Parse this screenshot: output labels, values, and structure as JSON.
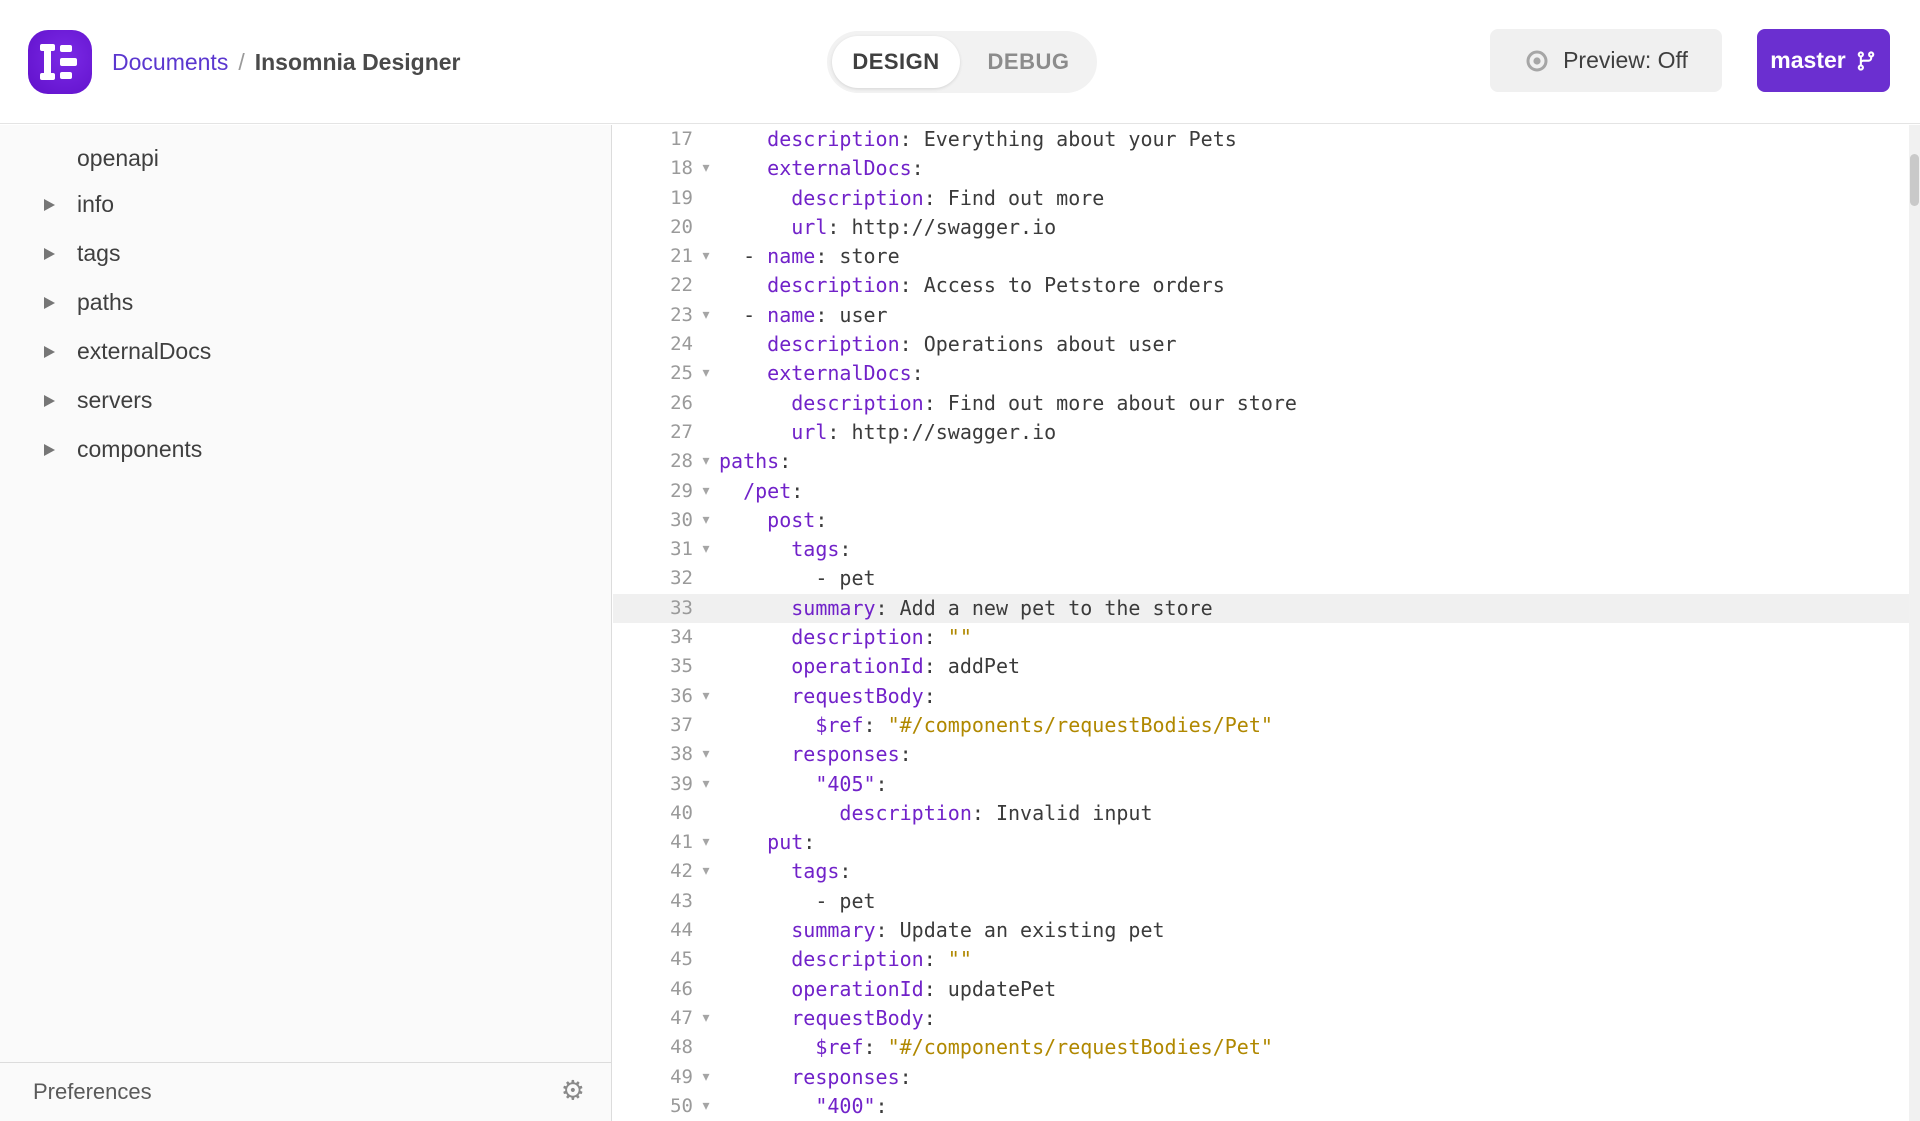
{
  "header": {
    "breadcrumb": {
      "link": "Documents",
      "separator": "/",
      "current": "Insomnia Designer"
    },
    "toggle": {
      "design_label": "DESIGN",
      "debug_label": "DEBUG",
      "active": "DESIGN"
    },
    "preview_label": "Preview: Off",
    "branch_label": "master"
  },
  "sidebar": {
    "items": [
      {
        "label": "openapi",
        "has_arrow": false
      },
      {
        "label": "info",
        "has_arrow": true
      },
      {
        "label": "tags",
        "has_arrow": true
      },
      {
        "label": "paths",
        "has_arrow": true
      },
      {
        "label": "externalDocs",
        "has_arrow": true
      },
      {
        "label": "servers",
        "has_arrow": true
      },
      {
        "label": "components",
        "has_arrow": true
      }
    ],
    "preferences_label": "Preferences",
    "gear_icon": "gear"
  },
  "editor": {
    "language": "yaml",
    "active_line": 33,
    "first_line": 17,
    "last_line": 50,
    "lines": [
      {
        "n": 17,
        "fold": false,
        "tokens": [
          [
            "p",
            "    "
          ],
          [
            "k",
            "description"
          ],
          [
            "p",
            ": Everything about your Pets"
          ]
        ]
      },
      {
        "n": 18,
        "fold": true,
        "tokens": [
          [
            "p",
            "    "
          ],
          [
            "k",
            "externalDocs"
          ],
          [
            "p",
            ":"
          ]
        ]
      },
      {
        "n": 19,
        "fold": false,
        "tokens": [
          [
            "p",
            "      "
          ],
          [
            "k",
            "description"
          ],
          [
            "p",
            ": Find out more"
          ]
        ]
      },
      {
        "n": 20,
        "fold": false,
        "tokens": [
          [
            "p",
            "      "
          ],
          [
            "k",
            "url"
          ],
          [
            "p",
            ": http://swagger.io"
          ]
        ]
      },
      {
        "n": 21,
        "fold": true,
        "tokens": [
          [
            "p",
            "  - "
          ],
          [
            "k",
            "name"
          ],
          [
            "p",
            ": store"
          ]
        ]
      },
      {
        "n": 22,
        "fold": false,
        "tokens": [
          [
            "p",
            "    "
          ],
          [
            "k",
            "description"
          ],
          [
            "p",
            ": Access to Petstore orders"
          ]
        ]
      },
      {
        "n": 23,
        "fold": true,
        "tokens": [
          [
            "p",
            "  - "
          ],
          [
            "k",
            "name"
          ],
          [
            "p",
            ": user"
          ]
        ]
      },
      {
        "n": 24,
        "fold": false,
        "tokens": [
          [
            "p",
            "    "
          ],
          [
            "k",
            "description"
          ],
          [
            "p",
            ": Operations about user"
          ]
        ]
      },
      {
        "n": 25,
        "fold": true,
        "tokens": [
          [
            "p",
            "    "
          ],
          [
            "k",
            "externalDocs"
          ],
          [
            "p",
            ":"
          ]
        ]
      },
      {
        "n": 26,
        "fold": false,
        "tokens": [
          [
            "p",
            "      "
          ],
          [
            "k",
            "description"
          ],
          [
            "p",
            ": Find out more about our store"
          ]
        ]
      },
      {
        "n": 27,
        "fold": false,
        "tokens": [
          [
            "p",
            "      "
          ],
          [
            "k",
            "url"
          ],
          [
            "p",
            ": http://swagger.io"
          ]
        ]
      },
      {
        "n": 28,
        "fold": true,
        "tokens": [
          [
            "k",
            "paths"
          ],
          [
            "p",
            ":"
          ]
        ]
      },
      {
        "n": 29,
        "fold": true,
        "tokens": [
          [
            "p",
            "  "
          ],
          [
            "k",
            "/pet"
          ],
          [
            "p",
            ":"
          ]
        ]
      },
      {
        "n": 30,
        "fold": true,
        "tokens": [
          [
            "p",
            "    "
          ],
          [
            "k",
            "post"
          ],
          [
            "p",
            ":"
          ]
        ]
      },
      {
        "n": 31,
        "fold": true,
        "tokens": [
          [
            "p",
            "      "
          ],
          [
            "k",
            "tags"
          ],
          [
            "p",
            ":"
          ]
        ]
      },
      {
        "n": 32,
        "fold": false,
        "tokens": [
          [
            "p",
            "        - pet"
          ]
        ]
      },
      {
        "n": 33,
        "fold": false,
        "tokens": [
          [
            "p",
            "      "
          ],
          [
            "k",
            "summary"
          ],
          [
            "p",
            ": Add a new pet to the store"
          ]
        ]
      },
      {
        "n": 34,
        "fold": false,
        "tokens": [
          [
            "p",
            "      "
          ],
          [
            "k",
            "description"
          ],
          [
            "p",
            ": "
          ],
          [
            "s",
            "\"\""
          ]
        ]
      },
      {
        "n": 35,
        "fold": false,
        "tokens": [
          [
            "p",
            "      "
          ],
          [
            "k",
            "operationId"
          ],
          [
            "p",
            ": addPet"
          ]
        ]
      },
      {
        "n": 36,
        "fold": true,
        "tokens": [
          [
            "p",
            "      "
          ],
          [
            "k",
            "requestBody"
          ],
          [
            "p",
            ":"
          ]
        ]
      },
      {
        "n": 37,
        "fold": false,
        "tokens": [
          [
            "p",
            "        "
          ],
          [
            "k",
            "$ref"
          ],
          [
            "p",
            ": "
          ],
          [
            "s",
            "\"#/components/requestBodies/Pet\""
          ]
        ]
      },
      {
        "n": 38,
        "fold": true,
        "tokens": [
          [
            "p",
            "      "
          ],
          [
            "k",
            "responses"
          ],
          [
            "p",
            ":"
          ]
        ]
      },
      {
        "n": 39,
        "fold": true,
        "tokens": [
          [
            "p",
            "        "
          ],
          [
            "k",
            "\"405\""
          ],
          [
            "p",
            ":"
          ]
        ]
      },
      {
        "n": 40,
        "fold": false,
        "tokens": [
          [
            "p",
            "          "
          ],
          [
            "k",
            "description"
          ],
          [
            "p",
            ": Invalid input"
          ]
        ]
      },
      {
        "n": 41,
        "fold": true,
        "tokens": [
          [
            "p",
            "    "
          ],
          [
            "k",
            "put"
          ],
          [
            "p",
            ":"
          ]
        ]
      },
      {
        "n": 42,
        "fold": true,
        "tokens": [
          [
            "p",
            "      "
          ],
          [
            "k",
            "tags"
          ],
          [
            "p",
            ":"
          ]
        ]
      },
      {
        "n": 43,
        "fold": false,
        "tokens": [
          [
            "p",
            "        - pet"
          ]
        ]
      },
      {
        "n": 44,
        "fold": false,
        "tokens": [
          [
            "p",
            "      "
          ],
          [
            "k",
            "summary"
          ],
          [
            "p",
            ": Update an existing pet"
          ]
        ]
      },
      {
        "n": 45,
        "fold": false,
        "tokens": [
          [
            "p",
            "      "
          ],
          [
            "k",
            "description"
          ],
          [
            "p",
            ": "
          ],
          [
            "s",
            "\"\""
          ]
        ]
      },
      {
        "n": 46,
        "fold": false,
        "tokens": [
          [
            "p",
            "      "
          ],
          [
            "k",
            "operationId"
          ],
          [
            "p",
            ": updatePet"
          ]
        ]
      },
      {
        "n": 47,
        "fold": true,
        "tokens": [
          [
            "p",
            "      "
          ],
          [
            "k",
            "requestBody"
          ],
          [
            "p",
            ":"
          ]
        ]
      },
      {
        "n": 48,
        "fold": false,
        "tokens": [
          [
            "p",
            "        "
          ],
          [
            "k",
            "$ref"
          ],
          [
            "p",
            ": "
          ],
          [
            "s",
            "\"#/components/requestBodies/Pet\""
          ]
        ]
      },
      {
        "n": 49,
        "fold": true,
        "tokens": [
          [
            "p",
            "      "
          ],
          [
            "k",
            "responses"
          ],
          [
            "p",
            ":"
          ]
        ]
      },
      {
        "n": 50,
        "fold": true,
        "tokens": [
          [
            "p",
            "        "
          ],
          [
            "k",
            "\"400\""
          ],
          [
            "p",
            ":"
          ]
        ]
      }
    ]
  },
  "colors": {
    "brand_purple": "#6b2fd0",
    "logo_purple": "#6c1fd6",
    "breadcrumb_link": "#5b37cf",
    "code_key": "#7122c9",
    "code_string": "#b08800",
    "code_plain": "#3b3b3b",
    "active_line_bg": "#f0f0f0",
    "sidebar_bg": "#fafafa"
  }
}
